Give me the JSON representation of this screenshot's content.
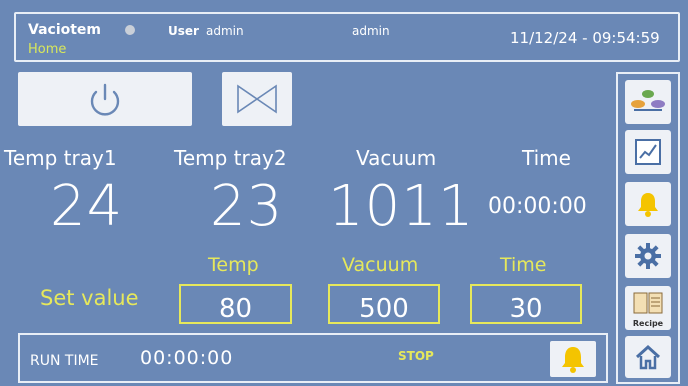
{
  "header": {
    "app_name": "Vaciotem",
    "breadcrumb": "Home",
    "user_label": "User",
    "user_value": "admin",
    "user_secondary": "admin",
    "datetime": "11/12/24 - 09:54:59"
  },
  "readings": {
    "temp_tray1_label": "Temp tray1",
    "temp_tray1_value": "24",
    "temp_tray2_label": "Temp tray2",
    "temp_tray2_value": "23",
    "vacuum_label": "Vacuum",
    "vacuum_value": "1011",
    "time_label": "Time",
    "time_value": "00:00:00"
  },
  "setpoints": {
    "set_value_label": "Set value",
    "temp_label": "Temp",
    "temp_value": "80",
    "vacuum_label": "Vacuum",
    "vacuum_value": "500",
    "time_label": "Time",
    "time_value": "30"
  },
  "runbar": {
    "run_label": "RUN TIME",
    "run_time": "00:00:00",
    "status": "STOP"
  },
  "sidebar": {
    "recipe_label": "Recipe"
  },
  "colors": {
    "background": "#6a88b6",
    "accent_yellow": "#e6e85b",
    "alarm_yellow": "#f4c400",
    "button_bg": "#eef1f6"
  },
  "icons": [
    "power-icon",
    "valve-icon",
    "process-icon",
    "trend-chart-icon",
    "alarm-bell-icon",
    "settings-gear-icon",
    "recipe-book-icon",
    "home-icon"
  ]
}
